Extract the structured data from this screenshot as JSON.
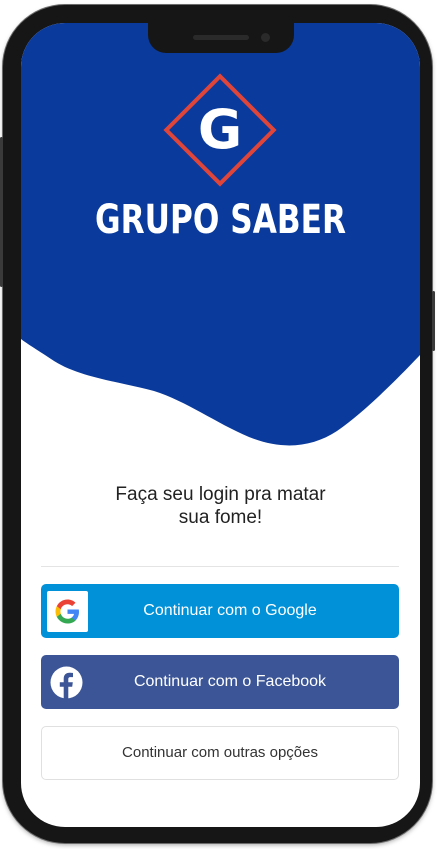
{
  "brand": {
    "name": "GRUPO SABER",
    "logo_letter": "G",
    "logo_icon": "g-diamond-logo-icon"
  },
  "login": {
    "tagline_line1": "Faça seu login pra matar",
    "tagline_line2": "sua fome!"
  },
  "buttons": {
    "google": {
      "label": "Continuar com o Google",
      "icon": "google-icon"
    },
    "facebook": {
      "label": "Continuar com o Facebook",
      "icon": "facebook-icon"
    },
    "other": {
      "label": "Continuar com outras opções"
    }
  },
  "colors": {
    "hero_blue": "#0a3a9c",
    "logo_red": "#e0453a",
    "google_button": "#0091d8",
    "facebook_button": "#3b5596"
  }
}
